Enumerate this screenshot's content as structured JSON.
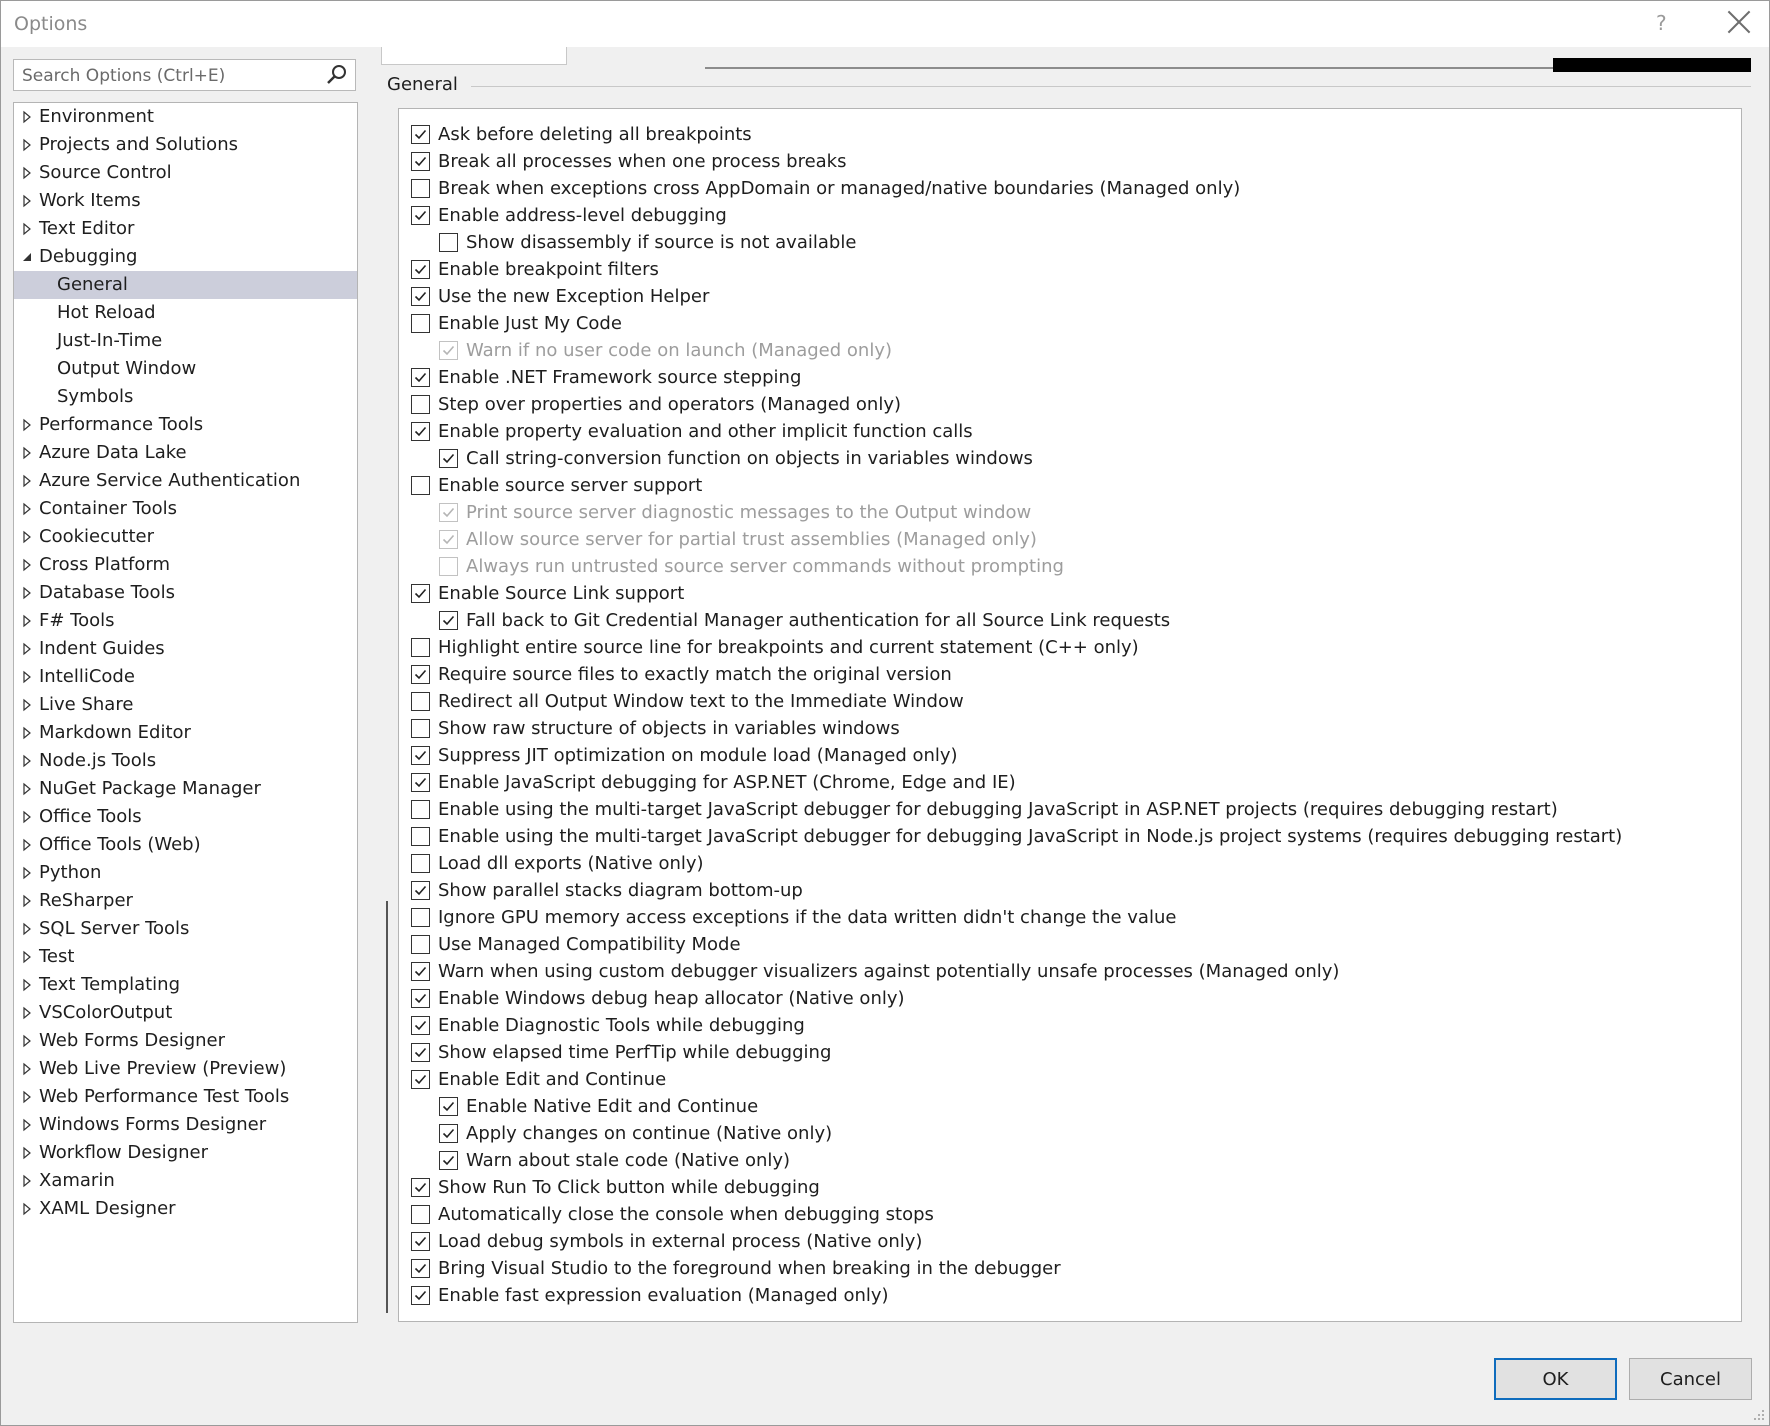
{
  "window": {
    "title": "Options",
    "help_glyph": "?"
  },
  "search": {
    "placeholder": "Search Options (Ctrl+E)"
  },
  "tree": {
    "items": [
      {
        "label": "Environment",
        "level": 0,
        "expanded": false,
        "selected": false
      },
      {
        "label": "Projects and Solutions",
        "level": 0,
        "expanded": false,
        "selected": false
      },
      {
        "label": "Source Control",
        "level": 0,
        "expanded": false,
        "selected": false
      },
      {
        "label": "Work Items",
        "level": 0,
        "expanded": false,
        "selected": false
      },
      {
        "label": "Text Editor",
        "level": 0,
        "expanded": false,
        "selected": false
      },
      {
        "label": "Debugging",
        "level": 0,
        "expanded": true,
        "selected": false
      },
      {
        "label": "General",
        "level": 1,
        "selected": true
      },
      {
        "label": "Hot Reload",
        "level": 1,
        "selected": false
      },
      {
        "label": "Just-In-Time",
        "level": 1,
        "selected": false
      },
      {
        "label": "Output Window",
        "level": 1,
        "selected": false
      },
      {
        "label": "Symbols",
        "level": 1,
        "selected": false
      },
      {
        "label": "Performance Tools",
        "level": 0,
        "expanded": false,
        "selected": false
      },
      {
        "label": "Azure Data Lake",
        "level": 0,
        "expanded": false,
        "selected": false
      },
      {
        "label": "Azure Service Authentication",
        "level": 0,
        "expanded": false,
        "selected": false
      },
      {
        "label": "Container Tools",
        "level": 0,
        "expanded": false,
        "selected": false
      },
      {
        "label": "Cookiecutter",
        "level": 0,
        "expanded": false,
        "selected": false
      },
      {
        "label": "Cross Platform",
        "level": 0,
        "expanded": false,
        "selected": false
      },
      {
        "label": "Database Tools",
        "level": 0,
        "expanded": false,
        "selected": false
      },
      {
        "label": "F# Tools",
        "level": 0,
        "expanded": false,
        "selected": false
      },
      {
        "label": "Indent Guides",
        "level": 0,
        "expanded": false,
        "selected": false
      },
      {
        "label": "IntelliCode",
        "level": 0,
        "expanded": false,
        "selected": false
      },
      {
        "label": "Live Share",
        "level": 0,
        "expanded": false,
        "selected": false
      },
      {
        "label": "Markdown Editor",
        "level": 0,
        "expanded": false,
        "selected": false
      },
      {
        "label": "Node.js Tools",
        "level": 0,
        "expanded": false,
        "selected": false
      },
      {
        "label": "NuGet Package Manager",
        "level": 0,
        "expanded": false,
        "selected": false
      },
      {
        "label": "Office Tools",
        "level": 0,
        "expanded": false,
        "selected": false
      },
      {
        "label": "Office Tools (Web)",
        "level": 0,
        "expanded": false,
        "selected": false
      },
      {
        "label": "Python",
        "level": 0,
        "expanded": false,
        "selected": false
      },
      {
        "label": "ReSharper",
        "level": 0,
        "expanded": false,
        "selected": false
      },
      {
        "label": "SQL Server Tools",
        "level": 0,
        "expanded": false,
        "selected": false
      },
      {
        "label": "Test",
        "level": 0,
        "expanded": false,
        "selected": false
      },
      {
        "label": "Text Templating",
        "level": 0,
        "expanded": false,
        "selected": false
      },
      {
        "label": "VSColorOutput",
        "level": 0,
        "expanded": false,
        "selected": false
      },
      {
        "label": "Web Forms Designer",
        "level": 0,
        "expanded": false,
        "selected": false
      },
      {
        "label": "Web Live Preview (Preview)",
        "level": 0,
        "expanded": false,
        "selected": false
      },
      {
        "label": "Web Performance Test Tools",
        "level": 0,
        "expanded": false,
        "selected": false
      },
      {
        "label": "Windows Forms Designer",
        "level": 0,
        "expanded": false,
        "selected": false
      },
      {
        "label": "Workflow Designer",
        "level": 0,
        "expanded": false,
        "selected": false
      },
      {
        "label": "Xamarin",
        "level": 0,
        "expanded": false,
        "selected": false
      },
      {
        "label": "XAML Designer",
        "level": 0,
        "expanded": false,
        "selected": false
      }
    ]
  },
  "group": {
    "title": "General"
  },
  "options": [
    {
      "label": "Ask before deleting all breakpoints",
      "checked": true,
      "indent": 0,
      "disabled": false
    },
    {
      "label": "Break all processes when one process breaks",
      "checked": true,
      "indent": 0,
      "disabled": false
    },
    {
      "label": "Break when exceptions cross AppDomain or managed/native boundaries (Managed only)",
      "checked": false,
      "indent": 0,
      "disabled": false
    },
    {
      "label": "Enable address-level debugging",
      "checked": true,
      "indent": 0,
      "disabled": false
    },
    {
      "label": "Show disassembly if source is not available",
      "checked": false,
      "indent": 1,
      "disabled": false
    },
    {
      "label": "Enable breakpoint filters",
      "checked": true,
      "indent": 0,
      "disabled": false
    },
    {
      "label": "Use the new Exception Helper",
      "checked": true,
      "indent": 0,
      "disabled": false
    },
    {
      "label": "Enable Just My Code",
      "checked": false,
      "indent": 0,
      "disabled": false
    },
    {
      "label": "Warn if no user code on launch (Managed only)",
      "checked": true,
      "indent": 1,
      "disabled": true
    },
    {
      "label": "Enable .NET Framework source stepping",
      "checked": true,
      "indent": 0,
      "disabled": false
    },
    {
      "label": "Step over properties and operators (Managed only)",
      "checked": false,
      "indent": 0,
      "disabled": false
    },
    {
      "label": "Enable property evaluation and other implicit function calls",
      "checked": true,
      "indent": 0,
      "disabled": false
    },
    {
      "label": "Call string-conversion function on objects in variables windows",
      "checked": true,
      "indent": 1,
      "disabled": false
    },
    {
      "label": "Enable source server support",
      "checked": false,
      "indent": 0,
      "disabled": false
    },
    {
      "label": "Print source server diagnostic messages to the Output window",
      "checked": true,
      "indent": 1,
      "disabled": true
    },
    {
      "label": "Allow source server for partial trust assemblies (Managed only)",
      "checked": true,
      "indent": 1,
      "disabled": true
    },
    {
      "label": "Always run untrusted source server commands without prompting",
      "checked": false,
      "indent": 1,
      "disabled": true
    },
    {
      "label": "Enable Source Link support",
      "checked": true,
      "indent": 0,
      "disabled": false
    },
    {
      "label": "Fall back to Git Credential Manager authentication for all Source Link requests",
      "checked": true,
      "indent": 1,
      "disabled": false
    },
    {
      "label": "Highlight entire source line for breakpoints and current statement (C++ only)",
      "checked": false,
      "indent": 0,
      "disabled": false
    },
    {
      "label": "Require source files to exactly match the original version",
      "checked": true,
      "indent": 0,
      "disabled": false
    },
    {
      "label": "Redirect all Output Window text to the Immediate Window",
      "checked": false,
      "indent": 0,
      "disabled": false
    },
    {
      "label": "Show raw structure of objects in variables windows",
      "checked": false,
      "indent": 0,
      "disabled": false
    },
    {
      "label": "Suppress JIT optimization on module load (Managed only)",
      "checked": true,
      "indent": 0,
      "disabled": false
    },
    {
      "label": "Enable JavaScript debugging for ASP.NET (Chrome, Edge and IE)",
      "checked": true,
      "indent": 0,
      "disabled": false
    },
    {
      "label": "Enable using the multi-target JavaScript debugger for debugging JavaScript in ASP.NET projects (requires debugging restart)",
      "checked": false,
      "indent": 0,
      "disabled": false
    },
    {
      "label": "Enable using the multi-target JavaScript debugger for debugging JavaScript in Node.js project systems (requires debugging restart)",
      "checked": false,
      "indent": 0,
      "disabled": false
    },
    {
      "label": "Load dll exports (Native only)",
      "checked": false,
      "indent": 0,
      "disabled": false
    },
    {
      "label": "Show parallel stacks diagram bottom-up",
      "checked": true,
      "indent": 0,
      "disabled": false
    },
    {
      "label": "Ignore GPU memory access exceptions if the data written didn't change the value",
      "checked": false,
      "indent": 0,
      "disabled": false
    },
    {
      "label": "Use Managed Compatibility Mode",
      "checked": false,
      "indent": 0,
      "disabled": false
    },
    {
      "label": "Warn when using custom debugger visualizers against potentially unsafe processes (Managed only)",
      "checked": true,
      "indent": 0,
      "disabled": false
    },
    {
      "label": "Enable Windows debug heap allocator (Native only)",
      "checked": true,
      "indent": 0,
      "disabled": false
    },
    {
      "label": "Enable Diagnostic Tools while debugging",
      "checked": true,
      "indent": 0,
      "disabled": false
    },
    {
      "label": "Show elapsed time PerfTip while debugging",
      "checked": true,
      "indent": 0,
      "disabled": false
    },
    {
      "label": "Enable Edit and Continue",
      "checked": true,
      "indent": 0,
      "disabled": false
    },
    {
      "label": "Enable Native Edit and Continue",
      "checked": true,
      "indent": 1,
      "disabled": false
    },
    {
      "label": "Apply changes on continue (Native only)",
      "checked": true,
      "indent": 1,
      "disabled": false
    },
    {
      "label": "Warn about stale code (Native only)",
      "checked": true,
      "indent": 1,
      "disabled": false
    },
    {
      "label": "Show Run To Click button while debugging",
      "checked": true,
      "indent": 0,
      "disabled": false
    },
    {
      "label": "Automatically close the console when debugging stops",
      "checked": false,
      "indent": 0,
      "disabled": false
    },
    {
      "label": "Load debug symbols in external process (Native only)",
      "checked": true,
      "indent": 0,
      "disabled": false
    },
    {
      "label": "Bring Visual Studio to the foreground when breaking in the debugger",
      "checked": true,
      "indent": 0,
      "disabled": false
    },
    {
      "label": "Enable fast expression evaluation (Managed only)",
      "checked": true,
      "indent": 0,
      "disabled": false
    }
  ],
  "buttons": {
    "ok_label": "OK",
    "cancel_label": "Cancel"
  },
  "colors": {
    "selection": "#cccedb",
    "accent": "#0f6cbd",
    "disabled_text": "#9d9d9d"
  }
}
